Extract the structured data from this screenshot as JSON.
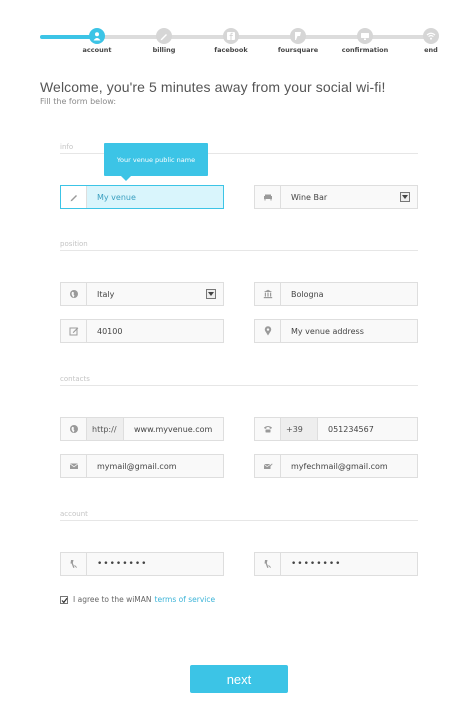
{
  "steps": [
    {
      "label": "account",
      "icon": "user-icon",
      "active": true
    },
    {
      "label": "billing",
      "icon": "pencil-icon",
      "active": false
    },
    {
      "label": "facebook",
      "icon": "facebook-icon",
      "active": false
    },
    {
      "label": "foursquare",
      "icon": "foursquare-icon",
      "active": false
    },
    {
      "label": "confirmation",
      "icon": "monitor-icon",
      "active": false
    },
    {
      "label": "end",
      "icon": "wifi-icon",
      "active": false
    }
  ],
  "header": {
    "title": "Welcome, you're 5 minutes away from your social wi-fi!",
    "subtitle": "Fill the form below:"
  },
  "sections": {
    "info": "info",
    "position": "position",
    "contacts": "contacts",
    "account": "account"
  },
  "tooltip": "Your venue public name",
  "fields": {
    "venue_name": "My venue",
    "venue_type": "Wine Bar",
    "country": "Italy",
    "city": "Bologna",
    "zip": "40100",
    "address": "My venue address",
    "website_prefix": "http://",
    "website": "www.myvenue.com",
    "phone_prefix": "+39",
    "phone": "051234567",
    "email": "mymail@gmail.com",
    "tech_email": "myfechmail@gmail.com",
    "password": "••••••••",
    "password_confirm": "••••••••"
  },
  "agreement": {
    "text": "I agree to the wiMAN",
    "link": "terms of service",
    "checked": true
  },
  "next_button": "next",
  "colors": {
    "accent": "#3cc4e6",
    "track": "#dcdcdc",
    "field_bg": "#f9f9f9",
    "field_border": "#dedede"
  }
}
